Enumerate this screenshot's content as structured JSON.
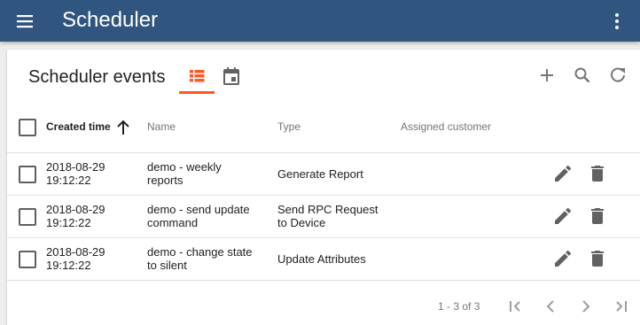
{
  "app": {
    "title": "Scheduler"
  },
  "panel": {
    "title": "Scheduler events"
  },
  "table": {
    "headers": {
      "created_time": "Created time",
      "name": "Name",
      "type": "Type",
      "customer": "Assigned customer"
    },
    "rows": [
      {
        "date": "2018-08-29",
        "time": "19:12:22",
        "name_1": "demo - weekly",
        "name_2": "reports",
        "type_1": "Generate Report",
        "type_2": "",
        "customer": ""
      },
      {
        "date": "2018-08-29",
        "time": "19:12:22",
        "name_1": "demo - send update",
        "name_2": "command",
        "type_1": "Send RPC Request",
        "type_2": "to Device",
        "customer": ""
      },
      {
        "date": "2018-08-29",
        "time": "19:12:22",
        "name_1": "demo - change state",
        "name_2": "to silent",
        "type_1": "Update Attributes",
        "type_2": "",
        "customer": ""
      }
    ]
  },
  "pagination": {
    "range": "1 - 3 of 3"
  },
  "colors": {
    "appbar": "#305680",
    "accent": "#ff5722",
    "icon": "#757575"
  },
  "icons": [
    "menu-icon",
    "more-vert-icon",
    "list-icon",
    "calendar-icon",
    "add-icon",
    "search-icon",
    "refresh-icon",
    "arrow-upward-icon",
    "edit-icon",
    "delete-icon",
    "first-page-icon",
    "chevron-left-icon",
    "chevron-right-icon",
    "last-page-icon"
  ]
}
